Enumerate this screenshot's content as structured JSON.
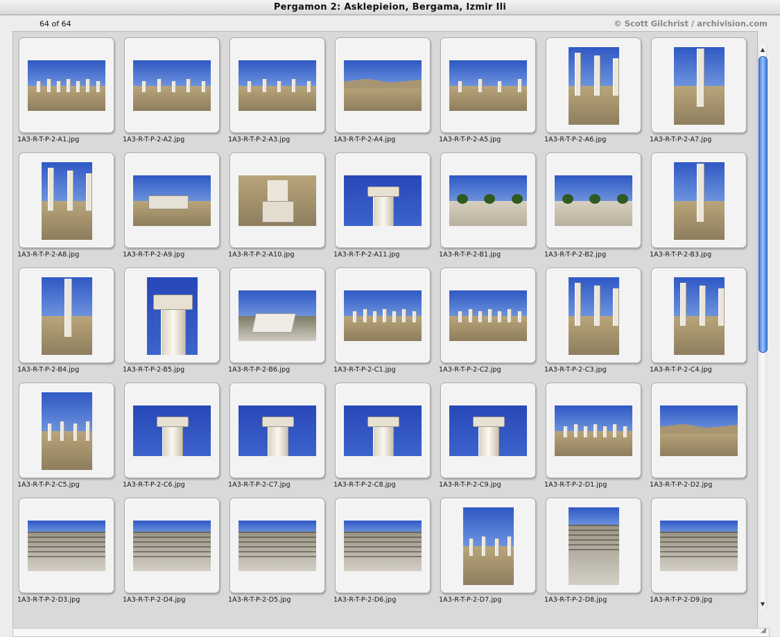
{
  "window": {
    "title": "Pergamon 2: Asklepieion, Bergama, Izmir Ili"
  },
  "header": {
    "count": "64 of 64",
    "copyright": "© Scott Gilchrist / archivision.com"
  },
  "icons": {
    "scroll_up": "up-arrow-icon",
    "scroll_down": "down-arrow-icon",
    "resize": "resize-grip-icon"
  },
  "slides": [
    {
      "file": "1A3-R-T-P-2-A1.jpg",
      "orientation": "landscape",
      "scene": "colonnade"
    },
    {
      "file": "1A3-R-T-P-2-A2.jpg",
      "orientation": "landscape",
      "scene": "street"
    },
    {
      "file": "1A3-R-T-P-2-A3.jpg",
      "orientation": "landscape",
      "scene": "street"
    },
    {
      "file": "1A3-R-T-P-2-A4.jpg",
      "orientation": "landscape",
      "scene": "hills"
    },
    {
      "file": "1A3-R-T-P-2-A5.jpg",
      "orientation": "landscape",
      "scene": "road"
    },
    {
      "file": "1A3-R-T-P-2-A6.jpg",
      "orientation": "portrait",
      "scene": "columns"
    },
    {
      "file": "1A3-R-T-P-2-A7.jpg",
      "orientation": "portrait",
      "scene": "column"
    },
    {
      "file": "1A3-R-T-P-2-A8.jpg",
      "orientation": "portrait",
      "scene": "columns"
    },
    {
      "file": "1A3-R-T-P-2-A9.jpg",
      "orientation": "landscape",
      "scene": "building"
    },
    {
      "file": "1A3-R-T-P-2-A10.jpg",
      "orientation": "landscape",
      "scene": "base"
    },
    {
      "file": "1A3-R-T-P-2-A11.jpg",
      "orientation": "landscape",
      "scene": "capital"
    },
    {
      "file": "1A3-R-T-P-2-B1.jpg",
      "orientation": "landscape",
      "scene": "trees"
    },
    {
      "file": "1A3-R-T-P-2-B2.jpg",
      "orientation": "landscape",
      "scene": "trees"
    },
    {
      "file": "1A3-R-T-P-2-B3.jpg",
      "orientation": "portrait",
      "scene": "column"
    },
    {
      "file": "1A3-R-T-P-2-B4.jpg",
      "orientation": "portrait",
      "scene": "column"
    },
    {
      "file": "1A3-R-T-P-2-B5.jpg",
      "orientation": "portrait",
      "scene": "capital"
    },
    {
      "file": "1A3-R-T-P-2-B6.jpg",
      "orientation": "landscape",
      "scene": "rubble"
    },
    {
      "file": "1A3-R-T-P-2-C1.jpg",
      "orientation": "landscape",
      "scene": "colonnade"
    },
    {
      "file": "1A3-R-T-P-2-C2.jpg",
      "orientation": "landscape",
      "scene": "colonnade"
    },
    {
      "file": "1A3-R-T-P-2-C3.jpg",
      "orientation": "portrait",
      "scene": "columns"
    },
    {
      "file": "1A3-R-T-P-2-C4.jpg",
      "orientation": "portrait",
      "scene": "columns"
    },
    {
      "file": "1A3-R-T-P-2-C5.jpg",
      "orientation": "portrait",
      "scene": "road"
    },
    {
      "file": "1A3-R-T-P-2-C6.jpg",
      "orientation": "landscape",
      "scene": "capital"
    },
    {
      "file": "1A3-R-T-P-2-C7.jpg",
      "orientation": "landscape",
      "scene": "capital"
    },
    {
      "file": "1A3-R-T-P-2-C8.jpg",
      "orientation": "landscape",
      "scene": "capital"
    },
    {
      "file": "1A3-R-T-P-2-C9.jpg",
      "orientation": "landscape",
      "scene": "capital"
    },
    {
      "file": "1A3-R-T-P-2-D1.jpg",
      "orientation": "landscape",
      "scene": "colonnade"
    },
    {
      "file": "1A3-R-T-P-2-D2.jpg",
      "orientation": "landscape",
      "scene": "hills"
    },
    {
      "file": "1A3-R-T-P-2-D3.jpg",
      "orientation": "landscape",
      "scene": "theater"
    },
    {
      "file": "1A3-R-T-P-2-D4.jpg",
      "orientation": "landscape",
      "scene": "theater"
    },
    {
      "file": "1A3-R-T-P-2-D5.jpg",
      "orientation": "landscape",
      "scene": "theater"
    },
    {
      "file": "1A3-R-T-P-2-D6.jpg",
      "orientation": "landscape",
      "scene": "theater"
    },
    {
      "file": "1A3-R-T-P-2-D7.jpg",
      "orientation": "portrait",
      "scene": "road"
    },
    {
      "file": "1A3-R-T-P-2-D8.jpg",
      "orientation": "portrait",
      "scene": "theater"
    },
    {
      "file": "1A3-R-T-P-2-D9.jpg",
      "orientation": "landscape",
      "scene": "theater"
    }
  ]
}
